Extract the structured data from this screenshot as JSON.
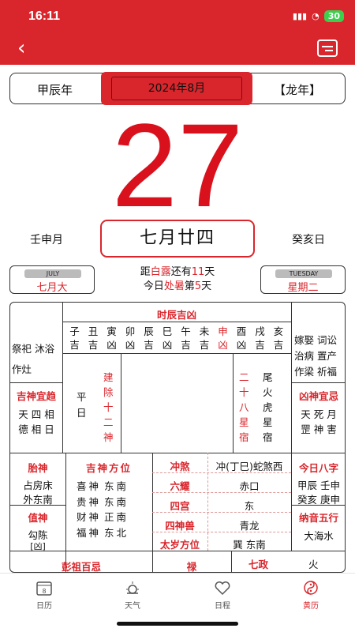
{
  "status": {
    "time": "16:11",
    "battery": "30"
  },
  "header": {
    "gz_year": "甲辰年",
    "month_selector": "2024年8月",
    "zodiac": "【龙年】"
  },
  "day": {
    "number": "27",
    "gz_month": "壬申月",
    "lunar_date": "七月廿四",
    "gz_day": "癸亥日",
    "left_tag": {
      "label": "JULY",
      "value": "七月大"
    },
    "right_tag": {
      "label": "TUESDAY",
      "value": "星期二"
    },
    "solar_line1": {
      "a": "距",
      "term": "白露",
      "b": "还有",
      "num": "11",
      "c": "天"
    },
    "solar_line2": {
      "a": "今日",
      "term": "处暑",
      "b": "第",
      "num": "5",
      "c": "天"
    }
  },
  "almanac": {
    "yi_items": "祭祀 沐浴 作灶",
    "ji_items": "嫁娶 词讼 治病 置产 作梁 祈福",
    "hour_title": "时辰吉凶",
    "hours": [
      {
        "branch": "子",
        "luck": "吉"
      },
      {
        "branch": "丑",
        "luck": "吉"
      },
      {
        "branch": "寅",
        "luck": "凶"
      },
      {
        "branch": "卯",
        "luck": "凶"
      },
      {
        "branch": "辰",
        "luck": "吉"
      },
      {
        "branch": "巳",
        "luck": "凶"
      },
      {
        "branch": "午",
        "luck": "吉"
      },
      {
        "branch": "未",
        "luck": "吉"
      },
      {
        "branch": "申",
        "luck": "凶"
      },
      {
        "branch": "酉",
        "luck": "凶"
      },
      {
        "branch": "戌",
        "luck": "吉"
      },
      {
        "branch": "亥",
        "luck": "吉"
      }
    ],
    "jishen_title": "吉神宜趋",
    "jishen_row1": "天 四 相",
    "jishen_row2": "德 相 日",
    "xiongshen_title": "凶神宜忌",
    "xiongshen_row1": "天 死 月",
    "xiongshen_row2": "罡 神 害",
    "pingri": "平日",
    "jianchu_label": "建除十二神",
    "xiu_label": "二十八星宿",
    "xiu_value": "尾火虎星宿",
    "taishen_title": "胎神",
    "taishen_row1": "占房床",
    "taishen_row2": "外东南",
    "zhishen_title": "值神",
    "zhishen_value": "勾陈",
    "zhishen_tag": "[凶]",
    "direction_title": "吉神方位",
    "directions": [
      {
        "god": "喜神",
        "dir": "东南"
      },
      {
        "god": "贵神",
        "dir": "东南"
      },
      {
        "god": "财神",
        "dir": "正南"
      },
      {
        "god": "福神",
        "dir": "东北"
      }
    ],
    "chongsha_label": "冲煞",
    "chongsha_value": "冲(丁巳)蛇煞西",
    "liuyao_label": "六耀",
    "liuyao_value": "赤口",
    "jiugong_label": "四宫",
    "jiugong_value": "东",
    "sishen_label": "四神兽",
    "sishen_value": "青龙",
    "taisui_label": "太岁方位",
    "taisui_value": "巽 东南",
    "bazi_title": "今日八字",
    "bazi_row1": "甲辰 壬申",
    "bazi_row2": "癸亥 庚申",
    "nayin_title": "纳音五行",
    "nayin_value": "大海水",
    "pengzu_title": "彭祖百忌",
    "lu_title": "禄",
    "qizheng_title": "七政",
    "qizheng_value": "火"
  },
  "tabs": [
    {
      "label": "日历",
      "icon": "calendar-icon"
    },
    {
      "label": "天气",
      "icon": "weather-icon"
    },
    {
      "label": "日程",
      "icon": "schedule-icon"
    },
    {
      "label": "黄历",
      "icon": "almanac-icon"
    }
  ],
  "colors": {
    "brand": "#d9262c",
    "text": "#111111"
  }
}
